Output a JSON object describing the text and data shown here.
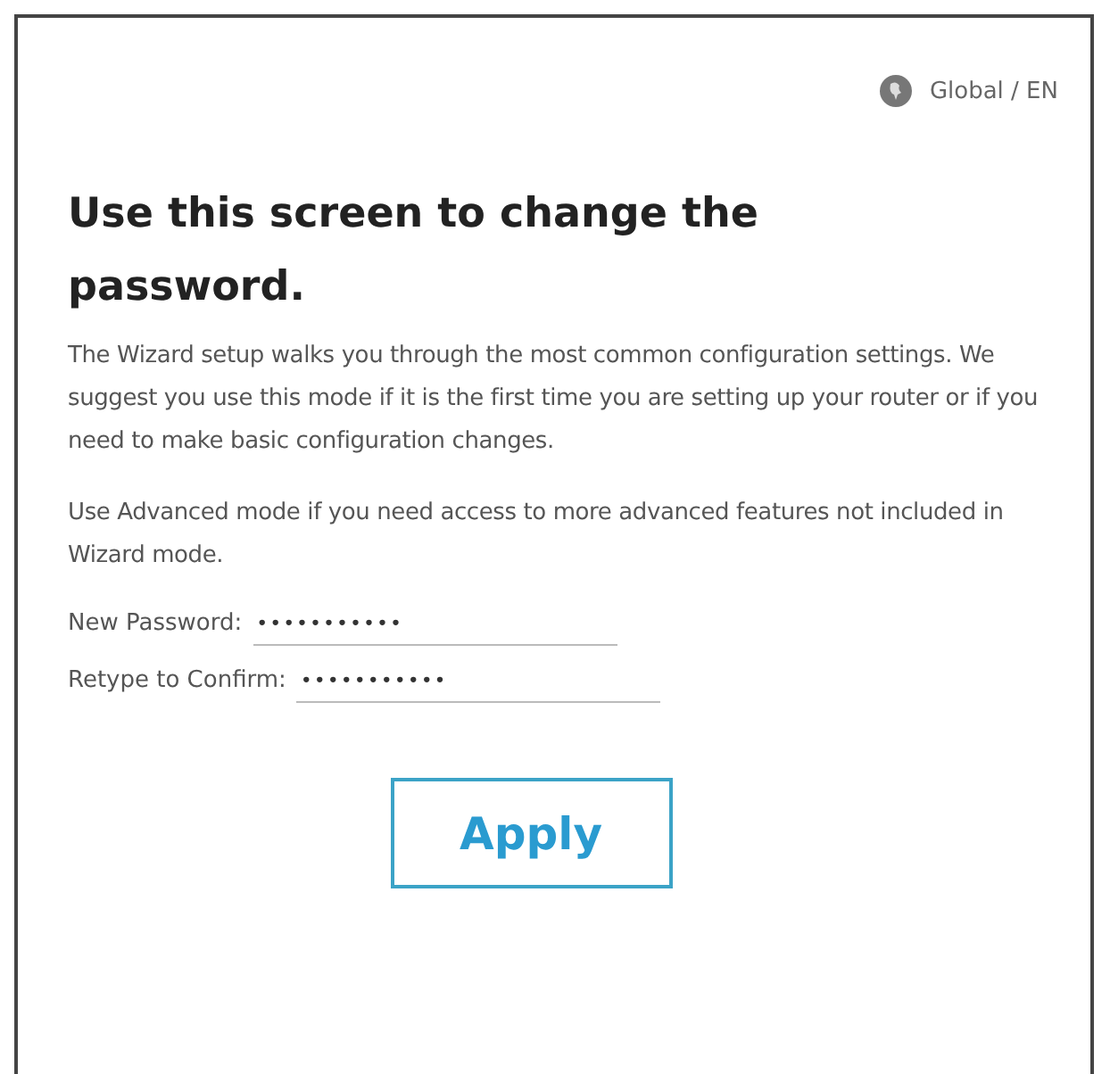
{
  "region": {
    "label": "Global / EN"
  },
  "heading": "Use this screen to change the password.",
  "paragraphs": [
    "The Wizard setup walks you through the most common configuration settings. We suggest you use this mode if it is the first time you are setting up your router or if you need to make basic configuration changes.",
    "Use Advanced mode if you need access to more advanced features not included in Wizard mode."
  ],
  "fields": [
    {
      "label": "New Password:",
      "value": "•••••••••••"
    },
    {
      "label": "Retype to Confirm:",
      "value": "•••••••••••"
    }
  ],
  "button": "Apply"
}
